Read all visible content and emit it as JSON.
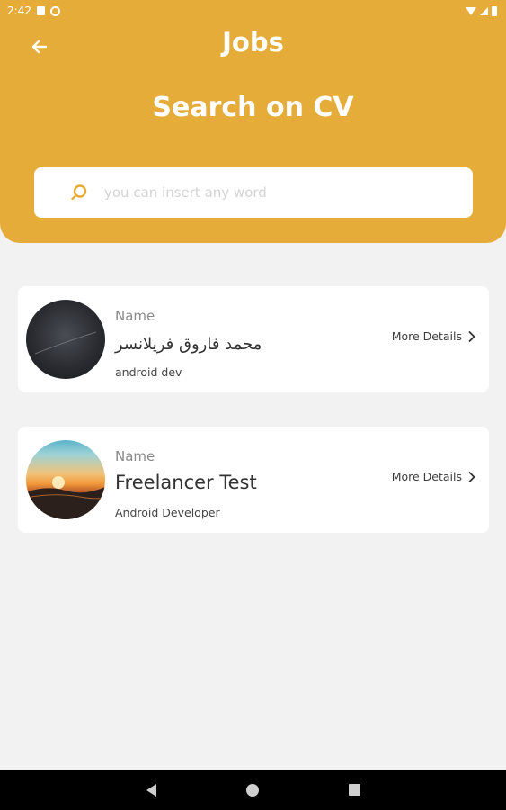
{
  "status_bar": {
    "time": "2:42",
    "icons": [
      "sd-card-icon",
      "sync-circle-icon",
      "wifi-icon",
      "signal-icon",
      "battery-icon"
    ]
  },
  "header": {
    "title": "Jobs",
    "back_icon": "arrow-left-icon",
    "search_heading": "Search on CV",
    "search_placeholder": "you can insert any word",
    "search_value": ""
  },
  "results": [
    {
      "name_label": "Name",
      "name": "محمد فاروق فريلانسر",
      "role": "android dev",
      "details_label": "More Details",
      "avatar": "asus-logo-avatar"
    },
    {
      "name_label": "Name",
      "name": "Freelancer Test",
      "role": "Android Developer",
      "details_label": "More Details",
      "avatar": "sunset-photo-avatar"
    }
  ],
  "nav_bar": {
    "buttons": [
      "back-triangle-icon",
      "home-circle-icon",
      "recents-square-icon"
    ]
  },
  "colors": {
    "accent": "#e5ac3a",
    "background": "#f2f2f2",
    "card": "#ffffff"
  }
}
